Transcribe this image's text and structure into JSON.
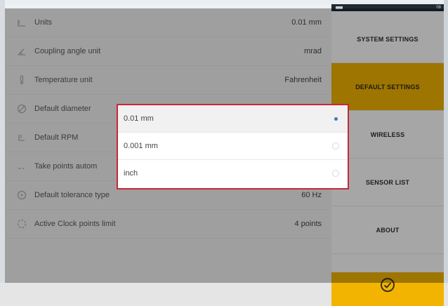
{
  "status_bar": {
    "text": "08"
  },
  "settings": {
    "rows": [
      {
        "icon": "ruler-icon",
        "label": "Units",
        "value": "0.01 mm"
      },
      {
        "icon": "coupling-angle-icon",
        "label": "Coupling angle unit",
        "value": "mrad"
      },
      {
        "icon": "thermometer-icon",
        "label": "Temperature unit",
        "value": "Fahrenheit"
      },
      {
        "icon": "diameter-icon",
        "label": "Default diameter",
        "value": ""
      },
      {
        "icon": "rpm-icon",
        "label": "Default RPM",
        "value": ""
      },
      {
        "icon": "points-icon",
        "label": "Take points autom",
        "value": ""
      },
      {
        "icon": "tolerance-icon",
        "label": "Default tolerance type",
        "value": "60 Hz"
      },
      {
        "icon": "clock-points-icon",
        "label": "Active Clock points limit",
        "value": "4 points"
      }
    ]
  },
  "menu": {
    "items": [
      {
        "label": "SYSTEM SETTINGS",
        "active": false
      },
      {
        "label": "DEFAULT SETTINGS",
        "active": true
      },
      {
        "label": "WIRELESS",
        "active": false
      },
      {
        "label": "SENSOR LIST",
        "active": false
      },
      {
        "label": "ABOUT",
        "active": false
      }
    ],
    "confirm_icon": "check-circle-icon"
  },
  "dropdown": {
    "options": [
      {
        "label": "0.01 mm",
        "selected": true
      },
      {
        "label": "0.001 mm",
        "selected": false
      },
      {
        "label": "inch",
        "selected": false
      }
    ]
  },
  "colors": {
    "accent": "#f2b400",
    "dialog_border": "#c8283a",
    "radio_selected": "#3f74c9"
  }
}
